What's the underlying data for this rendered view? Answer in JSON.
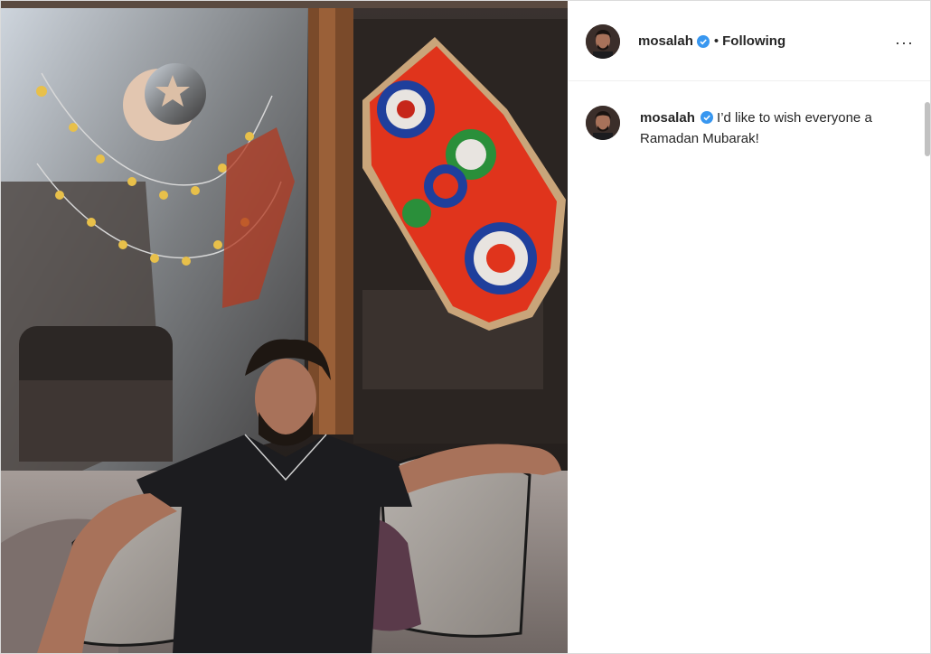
{
  "post": {
    "username": "mosalah",
    "follow_status": "Following",
    "separator": "•",
    "more_icon": "···",
    "caption_username": "mosalah",
    "caption_text": "I’d like to wish everyone a Ramadan Mubarak!",
    "verified_color": "#3897f0"
  },
  "photo": {
    "description_icon": "post-photo"
  }
}
